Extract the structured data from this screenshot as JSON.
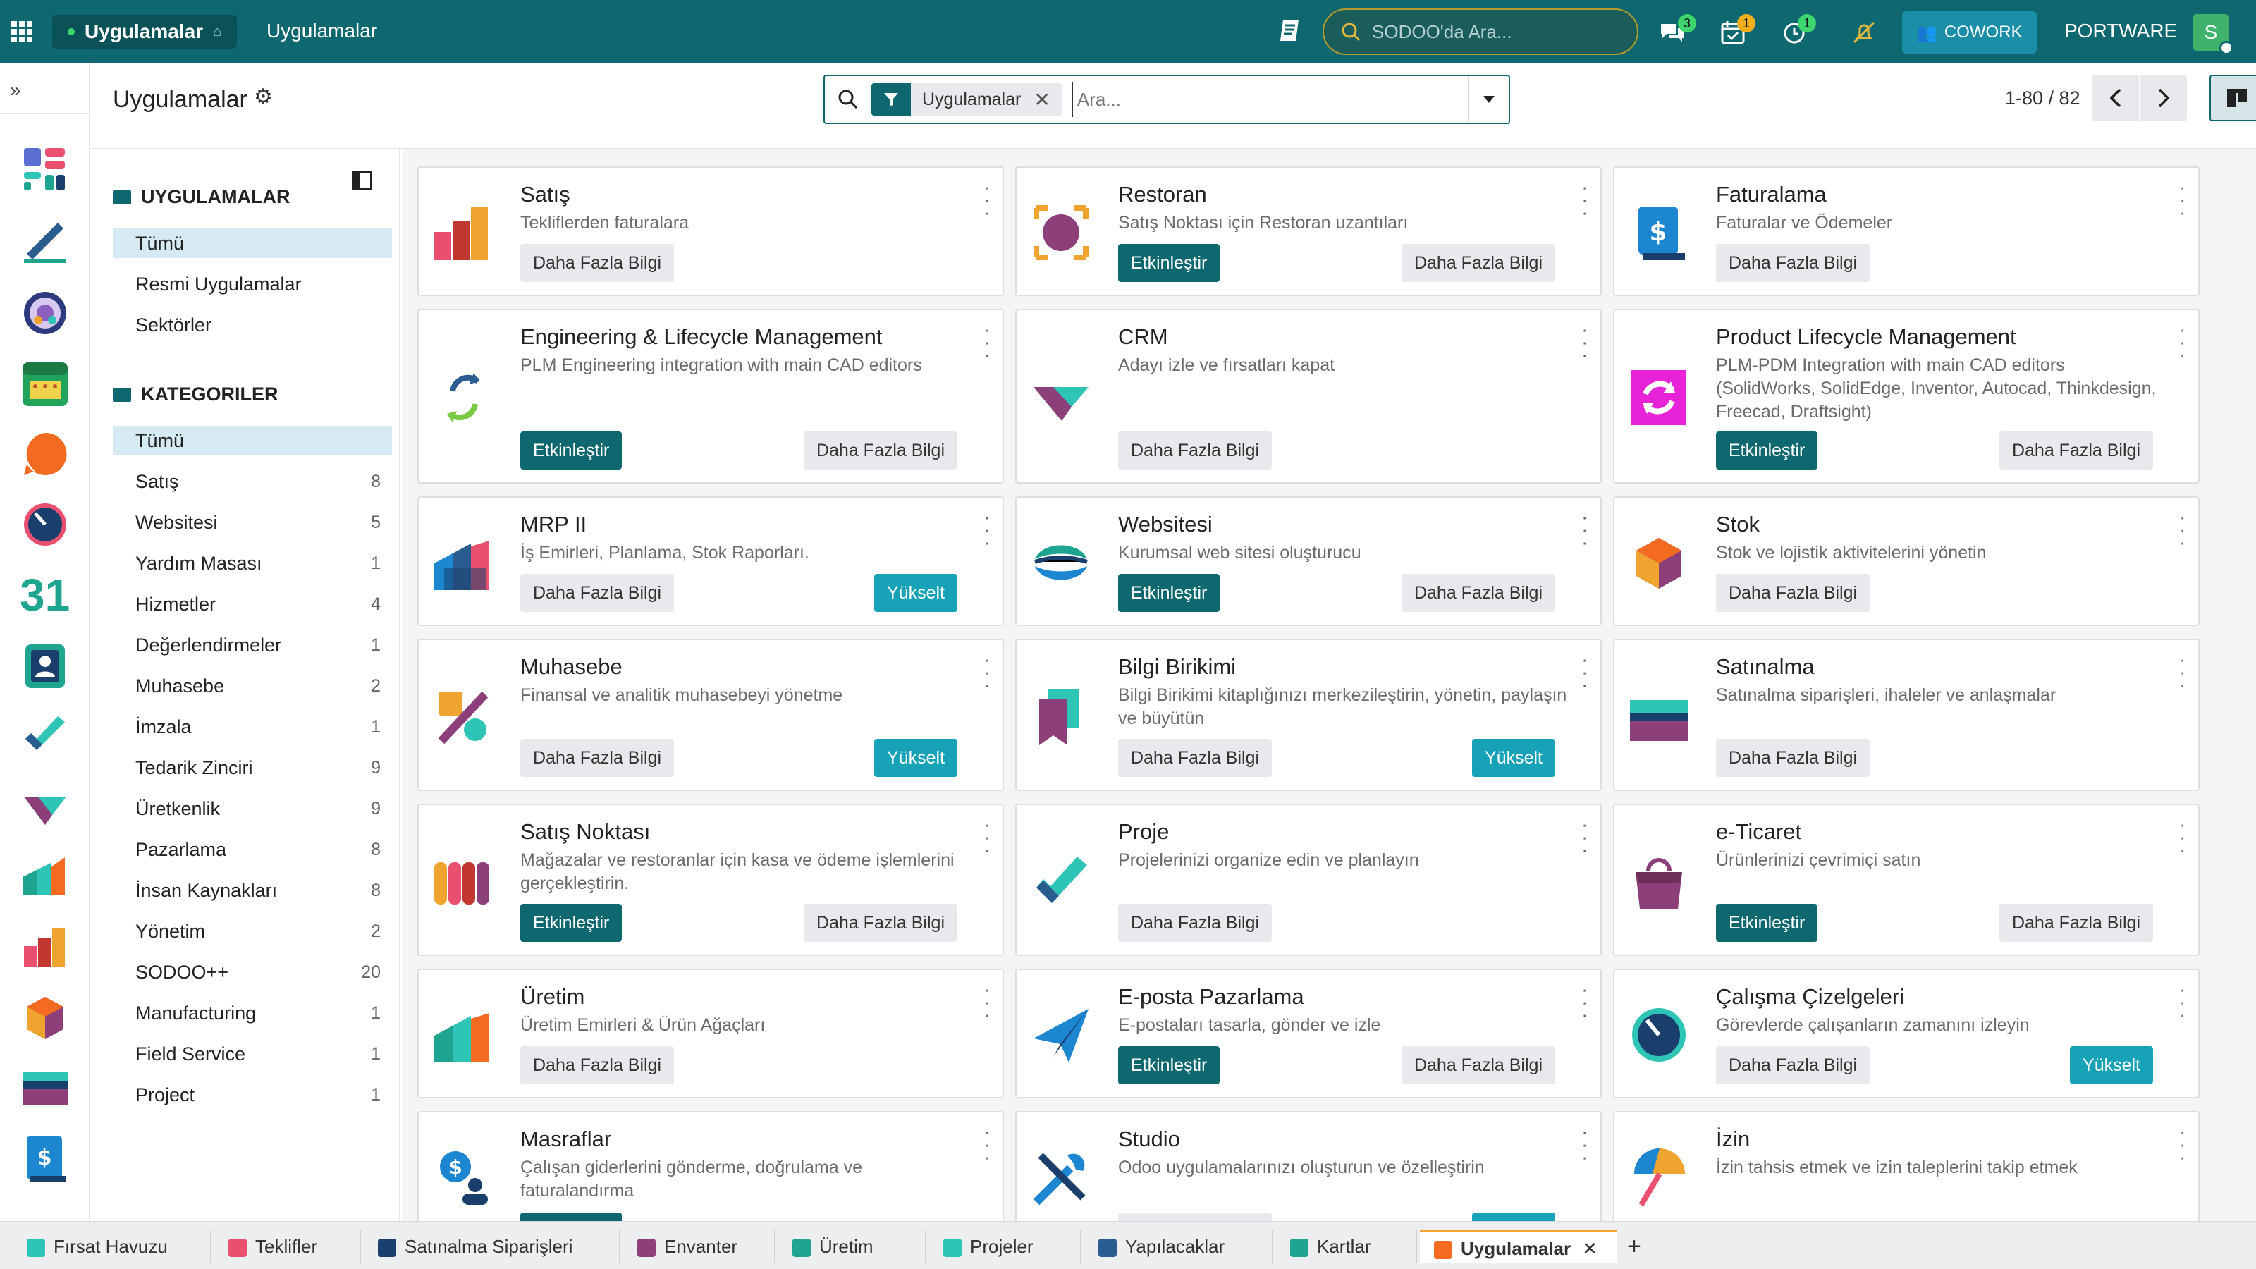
{
  "topbar": {
    "current_app": "Uygulamalar",
    "menu_app": "Uygulamalar",
    "search_placeholder": "SODOO'da Ara...",
    "chat_count": "3",
    "activity_count": "1",
    "timer_count": "1",
    "cowork_label": "COWORK",
    "company": "PORTWARE",
    "avatar_letter": "S"
  },
  "control_panel": {
    "title": "Uygulamalar",
    "facet_label": "Uygulamalar",
    "search_placeholder": "Ara...",
    "pager": "1-80 / 82"
  },
  "filters": {
    "section1_title": "UYGULAMALAR",
    "section1_items": [
      "Tümü",
      "Resmi Uygulamalar",
      "Sektörler"
    ],
    "section2_title": "KATEGORILER",
    "categories": [
      {
        "label": "Tümü",
        "count": ""
      },
      {
        "label": "Satış",
        "count": "8"
      },
      {
        "label": "Websitesi",
        "count": "5"
      },
      {
        "label": "Yardım Masası",
        "count": "1"
      },
      {
        "label": "Hizmetler",
        "count": "4"
      },
      {
        "label": "Değerlendirmeler",
        "count": "1"
      },
      {
        "label": "Muhasebe",
        "count": "2"
      },
      {
        "label": "İmzala",
        "count": "1"
      },
      {
        "label": "Tedarik Zinciri",
        "count": "9"
      },
      {
        "label": "Üretkenlik",
        "count": "9"
      },
      {
        "label": "Pazarlama",
        "count": "8"
      },
      {
        "label": "İnsan Kaynakları",
        "count": "8"
      },
      {
        "label": "Yönetim",
        "count": "2"
      },
      {
        "label": "SODOO++",
        "count": "20"
      },
      {
        "label": "Manufacturing",
        "count": "1"
      },
      {
        "label": "Field Service",
        "count": "1"
      },
      {
        "label": "Project",
        "count": "1"
      }
    ]
  },
  "buttons": {
    "more_info": "Daha Fazla Bilgi",
    "activate": "Etkinleştir",
    "upgrade": "Yükselt"
  },
  "apps": [
    {
      "name": "Satış",
      "desc": "Tekliflerden faturalara"
    },
    {
      "name": "Restoran",
      "desc": "Satış Noktası için Restoran uzantıları"
    },
    {
      "name": "Faturalama",
      "desc": "Faturalar ve Ödemeler"
    },
    {
      "name": "Engineering & Lifecycle Management",
      "desc": "PLM Engineering integration with main CAD editors"
    },
    {
      "name": "CRM",
      "desc": "Adayı izle ve fırsatları kapat"
    },
    {
      "name": "Product Lifecycle Management",
      "desc": "PLM-PDM Integration with main CAD editors (SolidWorks, SolidEdge, Inventor, Autocad, Thinkdesign, Freecad, Draftsight)"
    },
    {
      "name": "MRP II",
      "desc": "İş Emirleri, Planlama, Stok Raporları."
    },
    {
      "name": "Websitesi",
      "desc": "Kurumsal web sitesi oluşturucu"
    },
    {
      "name": "Stok",
      "desc": "Stok ve lojistik aktivitelerini yönetin"
    },
    {
      "name": "Muhasebe",
      "desc": "Finansal ve analitik muhasebeyi yönetme"
    },
    {
      "name": "Bilgi Birikimi",
      "desc": "Bilgi Birikimi kitaplığınızı merkezileştirin, yönetin, paylaşın ve büyütün"
    },
    {
      "name": "Satınalma",
      "desc": "Satınalma siparişleri, ihaleler ve anlaşmalar"
    },
    {
      "name": "Satış Noktası",
      "desc": "Mağazalar ve restoranlar için kasa ve ödeme işlemlerini gerçekleştirin."
    },
    {
      "name": "Proje",
      "desc": "Projelerinizi organize edin ve planlayın"
    },
    {
      "name": "e-Ticaret",
      "desc": "Ürünlerinizi çevrimiçi satın"
    },
    {
      "name": "Üretim",
      "desc": "Üretim Emirleri & Ürün Ağaçları"
    },
    {
      "name": "E-posta Pazarlama",
      "desc": "E-postaları tasarla, gönder ve izle"
    },
    {
      "name": "Çalışma Çizelgeleri",
      "desc": "Görevlerde çalışanların zamanını izleyin"
    },
    {
      "name": "Masraflar",
      "desc": "Çalışan giderlerini gönderme, doğrulama ve faturalandırma"
    },
    {
      "name": "Studio",
      "desc": "Odoo uygulamalarınızı oluşturun ve özelleştirin"
    },
    {
      "name": "İzin",
      "desc": "İzin tahsis etmek ve izin taleplerini takip etmek"
    }
  ],
  "bottom_tabs": [
    "Fırsat Havuzu",
    "Teklifler",
    "Satınalma Siparişleri",
    "Envanter",
    "Üretim",
    "Projeler",
    "Yapılacaklar",
    "Kartlar",
    "Uygulamalar"
  ],
  "colors": {
    "brand": "#0f6870",
    "upgrade": "#17a2b8",
    "selected_filter": "#d6eaf4"
  }
}
